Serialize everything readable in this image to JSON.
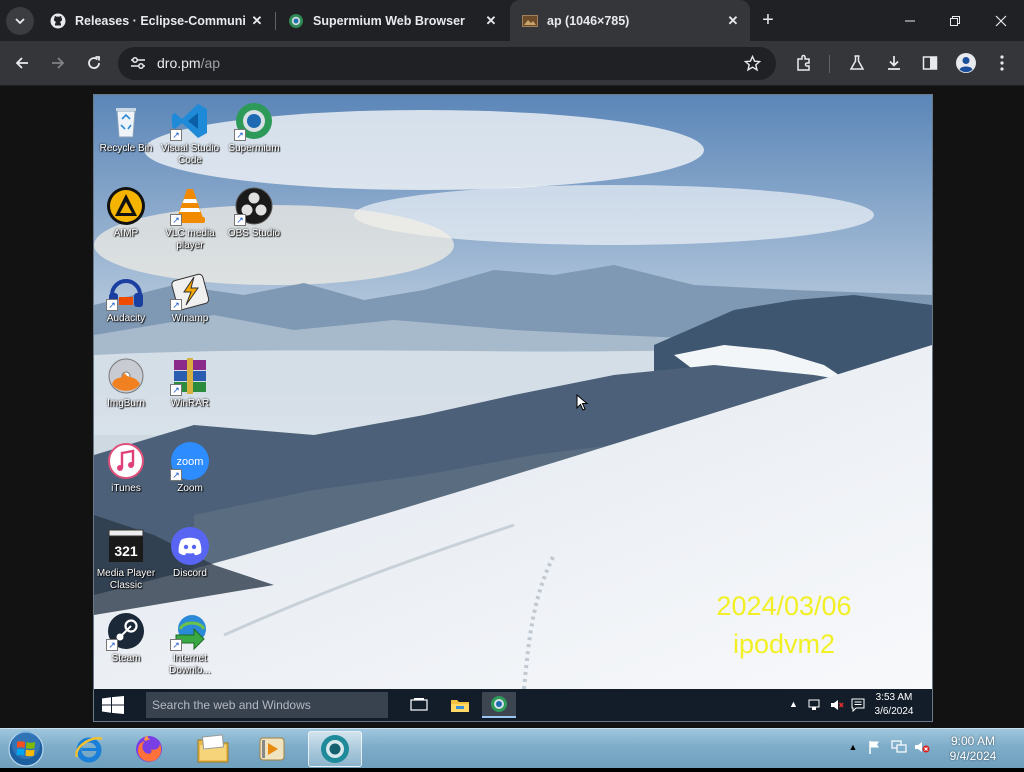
{
  "browser": {
    "tabs": [
      {
        "title": "Releases · Eclipse-Community/",
        "favicon": "github-icon",
        "active": false
      },
      {
        "title": "Supermium Web Browser",
        "favicon": "supermium-icon",
        "active": false
      },
      {
        "title": "ap (1046×785)",
        "favicon": "image-icon",
        "active": true
      }
    ],
    "new_tab_label": "+",
    "window_controls": [
      "minimize",
      "restore",
      "close"
    ],
    "url_host": "dro.pm",
    "url_path": "/ap",
    "toolbar_icons": [
      "back-icon",
      "forward-icon",
      "reload-icon",
      "site-info-icon",
      "bookmark-star-icon",
      "extensions-icon",
      "labs-icon",
      "download-icon",
      "side-panel-icon",
      "profile-icon",
      "menu-icon"
    ]
  },
  "vm": {
    "desktop_icons": [
      {
        "label": "Recycle Bin",
        "icon": "recycle-bin-icon"
      },
      {
        "label": "Visual Studio Code",
        "icon": "vscode-icon"
      },
      {
        "label": "Supermium",
        "icon": "supermium-icon"
      },
      {
        "label": "AIMP",
        "icon": "aimp-icon"
      },
      {
        "label": "VLC media player",
        "icon": "vlc-icon"
      },
      {
        "label": "OBS Studio",
        "icon": "obs-icon"
      },
      {
        "label": "Audacity",
        "icon": "audacity-icon"
      },
      {
        "label": "Winamp",
        "icon": "winamp-icon"
      },
      {
        "label": "ImgBurn",
        "icon": "imgburn-icon"
      },
      {
        "label": "WinRAR",
        "icon": "winrar-icon"
      },
      {
        "label": "iTunes",
        "icon": "itunes-icon"
      },
      {
        "label": "Zoom",
        "icon": "zoom-icon"
      },
      {
        "label": "Media Player Classic",
        "icon": "mpc-icon"
      },
      {
        "label": "Discord",
        "icon": "discord-icon"
      },
      {
        "label": "Steam",
        "icon": "steam-icon"
      },
      {
        "label": "Internet Downlo...",
        "icon": "idm-icon"
      }
    ],
    "watermark_date": "2024/03/06",
    "watermark_host": "ipodvm2",
    "taskbar": {
      "search_placeholder": "Search the web and Windows",
      "time": "3:53 AM",
      "date": "3/6/2024"
    }
  },
  "host": {
    "taskbar_apps": [
      "internet-explorer-icon",
      "firefox-icon",
      "explorer-folder-icon",
      "media-player-icon",
      "supermium-icon"
    ],
    "time": "9:00 AM",
    "date": "9/4/2024"
  },
  "colors": {
    "tabstrip": "#202124",
    "toolbar": "#35363a",
    "watermark": "#f2f000",
    "host_taskbar": "#7eadc9"
  }
}
